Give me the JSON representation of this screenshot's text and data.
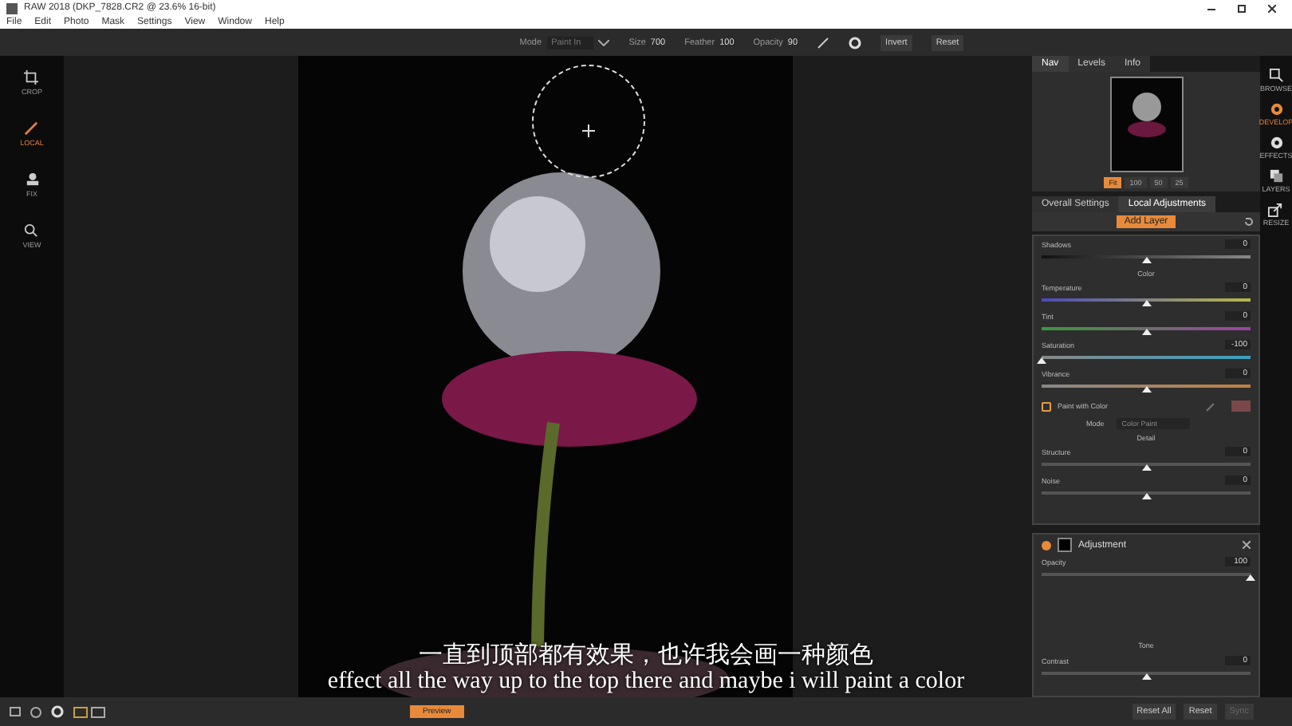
{
  "window": {
    "title": "RAW 2018 (DKP_7828.CR2 @ 23.6% 16-bit)"
  },
  "menu": [
    "File",
    "Edit",
    "Photo",
    "Mask",
    "Settings",
    "View",
    "Window",
    "Help"
  ],
  "toolbar": {
    "mode_label": "Mode",
    "mode_value": "Paint In",
    "size_label": "Size",
    "size_value": "700",
    "feather_label": "Feather",
    "feather_value": "100",
    "opacity_label": "Opacity",
    "opacity_value": "90",
    "buttons": [
      "Invert",
      "Reset"
    ]
  },
  "left_tools": [
    {
      "label": "CROP",
      "kind": "crop",
      "selected": false
    },
    {
      "label": "LOCAL",
      "kind": "brush",
      "selected": true
    },
    {
      "label": "FIX",
      "kind": "stamp",
      "selected": false
    },
    {
      "label": "VIEW",
      "kind": "zoom",
      "selected": false
    }
  ],
  "right_modules": [
    {
      "label": "BROWSE",
      "kind": "browse",
      "selected": false
    },
    {
      "label": "DEVELOP",
      "kind": "develop",
      "selected": true
    },
    {
      "label": "EFFECTS",
      "kind": "effects",
      "selected": false
    },
    {
      "label": "LAYERS",
      "kind": "layers",
      "selected": false
    },
    {
      "label": "RESIZE",
      "kind": "resize",
      "selected": false
    }
  ],
  "nav_tabs": [
    {
      "label": "Nav",
      "selected": true
    },
    {
      "label": "Levels",
      "selected": false
    },
    {
      "label": "Info",
      "selected": false
    }
  ],
  "zoom_buttons": [
    {
      "label": "Fit",
      "selected": true
    },
    {
      "label": "100",
      "selected": false
    },
    {
      "label": "50",
      "selected": false
    },
    {
      "label": "25",
      "selected": false
    }
  ],
  "settings_tabs": [
    {
      "label": "Overall Settings",
      "selected": false
    },
    {
      "label": "Local Adjustments",
      "selected": true
    }
  ],
  "add_layer": "Add Layer",
  "controls": [
    {
      "kind": "shadow",
      "label": "Shadows",
      "value": "0",
      "level": 0.5
    },
    {
      "kind": "heading",
      "label": "Color"
    },
    {
      "kind": "temperature",
      "label": "Temperature",
      "value": "0",
      "level": 0.5
    },
    {
      "kind": "tint",
      "label": "Tint",
      "value": "0",
      "level": 0.5
    },
    {
      "kind": "saturation",
      "label": "Saturation",
      "value": "-100",
      "level": 0
    },
    {
      "kind": "vibrance",
      "label": "Vibrance",
      "value": "0",
      "level": 0.5
    },
    {
      "kind": "checkbox",
      "label": "Paint with Color",
      "checked": false,
      "color": "#7a4848"
    },
    {
      "kind": "select",
      "label": "Mode",
      "value": "Color Paint"
    },
    {
      "kind": "heading",
      "label": "Detail"
    },
    {
      "kind": "slider",
      "label": "Structure",
      "value": "0",
      "level": 0.5
    },
    {
      "kind": "slider",
      "label": "Noise",
      "value": "0",
      "level": 0.5
    }
  ],
  "adjustment": {
    "title": "Adjustment",
    "opacity": {
      "label": "Opacity",
      "value": "100",
      "level": 1
    },
    "section": "Tone",
    "contrast": {
      "label": "Contrast",
      "value": "0",
      "level": 0.5
    }
  },
  "bottom": {
    "preview": "Preview",
    "buttons": [
      {
        "label": "Reset All",
        "disabled": false
      },
      {
        "label": "Reset",
        "disabled": false
      },
      {
        "label": "Sync",
        "disabled": true
      }
    ]
  },
  "captions": [
    "一直到顶部都有效果，也许我会画一种颜色",
    "effect all the way up to the top there and maybe i will paint a color"
  ]
}
